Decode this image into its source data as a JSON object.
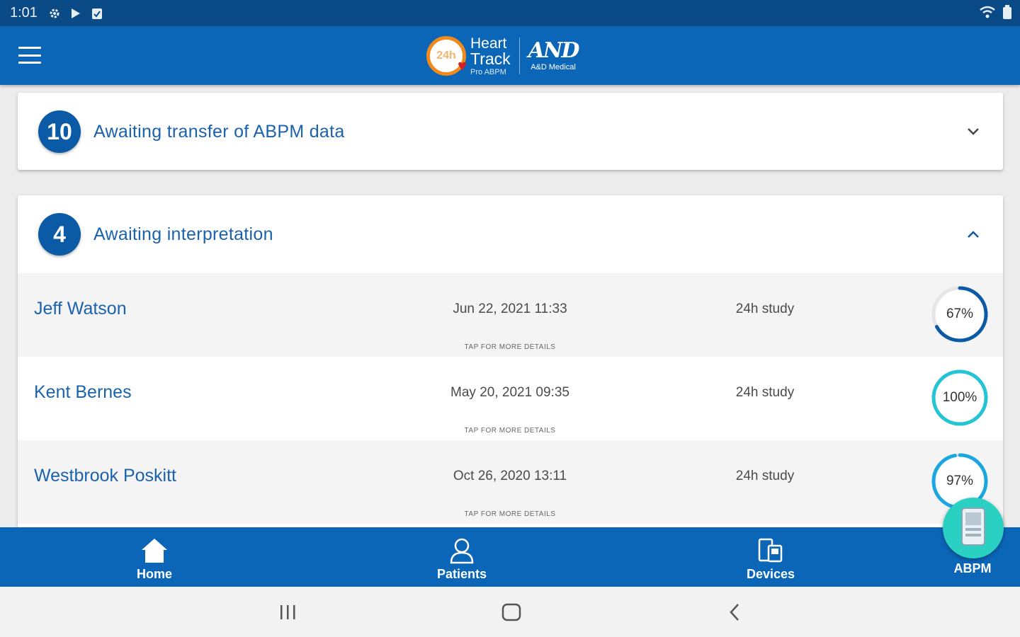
{
  "status_bar": {
    "time": "1:01",
    "icons": [
      "settings-icon",
      "play-store-icon",
      "clipboard-check-icon"
    ],
    "right_icons": [
      "wifi-icon",
      "battery-icon"
    ]
  },
  "app_bar": {
    "menu_icon": "hamburger-menu-icon",
    "logo": {
      "badge_text": "24h",
      "line1": "Heart",
      "line2": "Track",
      "line3": "Pro ABPM",
      "brand_mark": "AND",
      "brand_sub": "A&D Medical"
    }
  },
  "sections": [
    {
      "count": "10",
      "title": "Awaiting transfer of ABPM data",
      "expanded": false
    },
    {
      "count": "4",
      "title": "Awaiting interpretation",
      "expanded": true,
      "rows": [
        {
          "name": "Jeff Watson",
          "date": "Jun 22, 2021 11:33",
          "study": "24h study",
          "hint": "TAP FOR MORE DETAILS",
          "progress_label": "67%",
          "progress": 0.67
        },
        {
          "name": "Kent Bernes",
          "date": "May 20, 2021 09:35",
          "study": "24h study",
          "hint": "TAP FOR MORE DETAILS",
          "progress_label": "100%",
          "progress": 1.0
        },
        {
          "name": "Westbrook Poskitt",
          "date": "Oct 26, 2020 13:11",
          "study": "24h study",
          "hint": "TAP FOR MORE DETAILS",
          "progress_label": "97%",
          "progress": 0.97
        }
      ]
    }
  ],
  "bottom_nav": {
    "items": [
      {
        "label": "Home",
        "icon": "home-icon"
      },
      {
        "label": "Patients",
        "icon": "patients-icon"
      },
      {
        "label": "Devices",
        "icon": "devices-icon"
      },
      {
        "label": "ABPM",
        "icon": "abpm-device-icon"
      }
    ]
  },
  "colors": {
    "primary": "#0b66b8",
    "status_bar": "#0a4a86",
    "badge": "#0b5aa6",
    "link_text": "#1b62ad",
    "fab": "#2ad1c3",
    "progress_start": "#1aa6e0",
    "progress_end": "#0b5aa6",
    "progress_full": "#22c4d6"
  }
}
